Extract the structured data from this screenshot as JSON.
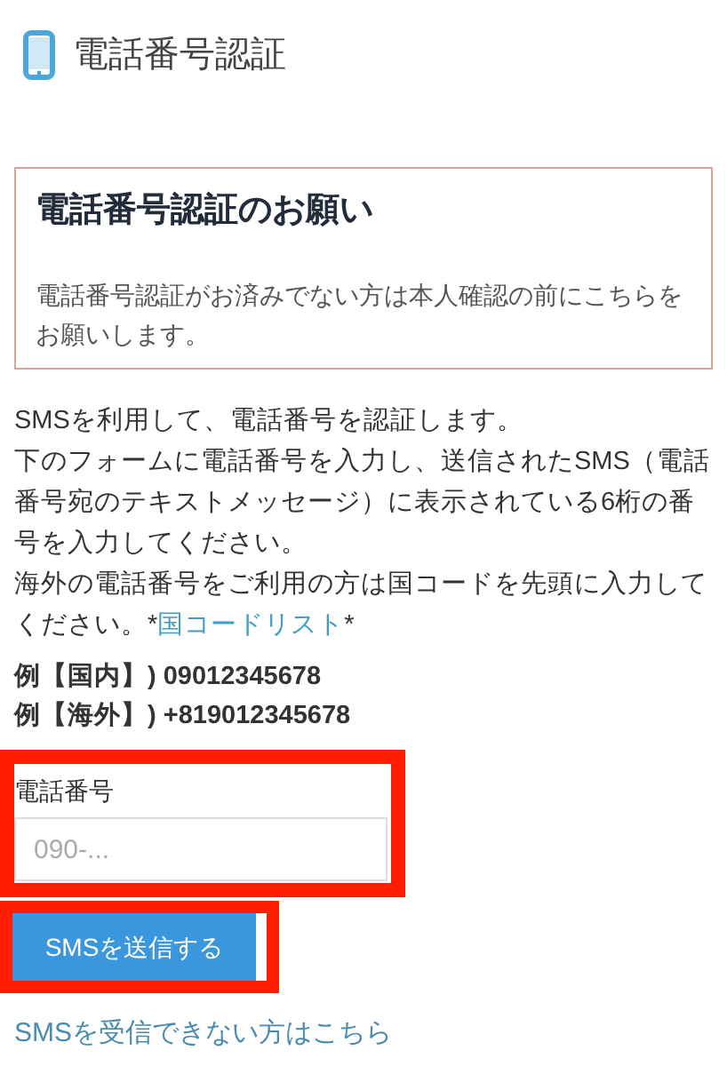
{
  "header": {
    "title": "電話番号認証"
  },
  "notice": {
    "title": "電話番号認証のお願い",
    "body": "電話番号認証がお済みでない方は本人確認の前にこちらをお願いします。"
  },
  "intro": [
    "SMSを利用して、電話番号を認証します。",
    "下のフォームに電話番号を入力し、送信されたSMS（電話番号宛のテキストメッセージ）に表示されている6桁の番号を入力してください。"
  ],
  "country_note": {
    "before": "海外の電話番号をご利用の方は国コードを先頭に入力してください。*",
    "link": "国コードリスト",
    "after": "*"
  },
  "examples": [
    "例【国内】) 09012345678",
    "例【海外】) +819012345678"
  ],
  "phone_field": {
    "label": "電話番号",
    "placeholder": "090-..."
  },
  "send_button": "SMSを送信する",
  "help_link": "SMSを受信できない方はこちら"
}
